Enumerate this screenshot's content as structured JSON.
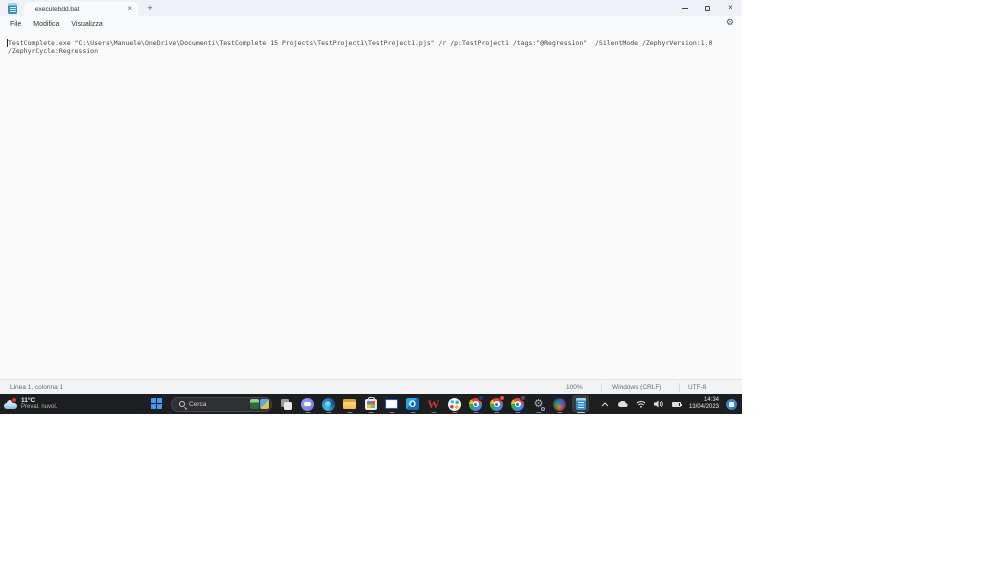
{
  "window": {
    "tab_title": "executebdd.bat",
    "new_tab_label": "+",
    "menu": {
      "file": "File",
      "edit": "Modifica",
      "view": "Visualizza"
    },
    "editor": {
      "lines": {
        "0": "TestComplete.exe \"C:\\Users\\Manuele\\OneDrive\\Documenti\\TestComplete 15 Projects\\TestProject1\\TestProject1.pjs\" /r /p:TestProject1 /tags:\"@Regression\"  /SilentMode /ZephyrVersion:1.0",
        "1": "/ZephyrCycle:Regression"
      }
    },
    "status": {
      "position": "Linea 1, colonna 1",
      "zoom": "100%",
      "line_ending": "Windows (CRLF)",
      "encoding": "UTF-8"
    },
    "icons": [
      "notepad-app-icon",
      "tab-close-icon",
      "new-tab-icon",
      "minimize-icon",
      "maximize-icon",
      "close-icon",
      "settings-gear-icon"
    ]
  },
  "taskbar": {
    "weather": {
      "temperature": "11°C",
      "condition": "Preval. nuvol."
    },
    "search": {
      "placeholder": "Cerca"
    },
    "apps": [
      "task-view",
      "teams-chat",
      "edge",
      "file-explorer",
      "microsoft-store",
      "mail",
      "outlook",
      "w-app",
      "slack",
      "chrome-profile-1",
      "chrome-profile-2",
      "chrome-profile-3",
      "gear-search-tool",
      "testcomplete",
      "notepad-active"
    ],
    "tray_icons": [
      "chevron-up",
      "onedrive-cloud",
      "wifi",
      "volume",
      "battery"
    ],
    "clock": {
      "time": "14:34",
      "date": "13/04/2023"
    },
    "colors": {
      "taskbar_bg": "#1d1e20",
      "accent_blue": "#3d9df0",
      "badge_red": "#d9352a"
    }
  }
}
